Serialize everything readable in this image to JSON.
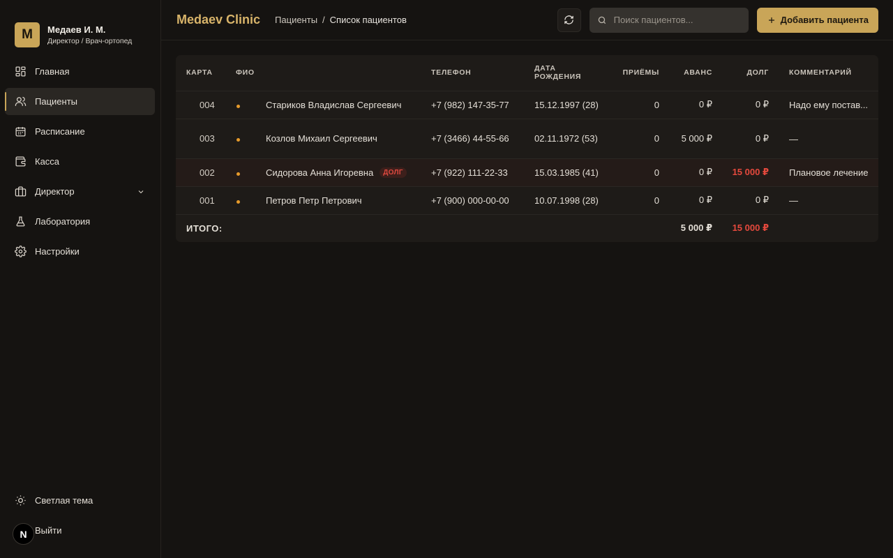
{
  "profile": {
    "avatar_letter": "M",
    "name": "Медаев И. М.",
    "role": "Директор / Врач-ортопед"
  },
  "nav": {
    "items": [
      {
        "label": "Главная",
        "icon": "grid-icon"
      },
      {
        "label": "Пациенты",
        "icon": "users-icon",
        "active": true
      },
      {
        "label": "Расписание",
        "icon": "calendar-icon"
      },
      {
        "label": "Касса",
        "icon": "wallet-icon"
      },
      {
        "label": "Директор",
        "icon": "briefcase-icon",
        "expandable": true
      },
      {
        "label": "Лаборатория",
        "icon": "flask-icon"
      },
      {
        "label": "Настройки",
        "icon": "gear-icon"
      }
    ],
    "bottom": [
      {
        "label": "Светлая тема",
        "icon": "sun-icon"
      },
      {
        "label": "Выйти",
        "icon": "logout-icon"
      }
    ],
    "badge_letter": "N"
  },
  "header": {
    "brand": "Medaev Clinic",
    "breadcrumb": [
      "Пациенты",
      "/",
      "Список пациентов"
    ],
    "search_placeholder": "Поиск пациентов...",
    "add_label": "Добавить пациента"
  },
  "table": {
    "columns": {
      "card": "КАРТА",
      "name": "ФИО",
      "phone": "ТЕЛЕФОН",
      "dob_line1": "ДАТА",
      "dob_line2": "РОЖДЕНИЯ",
      "visits": "ПРИЁМЫ",
      "advance": "АВАНС",
      "debt": "ДОЛГ",
      "comment": "КОММЕНТАРИЙ"
    },
    "rows": [
      {
        "card": "004",
        "name": "Стариков Владислав Сергеевич",
        "phone": "+7 (982) 147-35-77",
        "dob": "15.12.1997 (28)",
        "visits": "0",
        "advance": "0 ₽",
        "debt": "0 ₽",
        "comment": "Надо ему постав..."
      },
      {
        "card": "003",
        "name": "Козлов Михаил Сергеевич",
        "phone": "+7 (3466) 44-55-66",
        "dob": "02.11.1972 (53)",
        "visits": "0",
        "advance": "5 000 ₽",
        "debt": "0 ₽",
        "comment": "—"
      },
      {
        "card": "002",
        "name": "Сидорова Анна Игоревна",
        "badge": "ДОЛГ",
        "phone": "+7 (922) 111-22-33",
        "dob": "15.03.1985 (41)",
        "visits": "0",
        "advance": "0 ₽",
        "debt": "15 000 ₽",
        "comment": "Плановое лечение"
      },
      {
        "card": "001",
        "name": "Петров Петр Петрович",
        "phone": "+7 (900) 000-00-00",
        "dob": "10.07.1998 (28)",
        "visits": "0",
        "advance": "0 ₽",
        "debt": "0 ₽",
        "comment": "—"
      }
    ],
    "total": {
      "label": "ИТОГО:",
      "advance": "5 000 ₽",
      "debt": "15 000 ₽"
    }
  },
  "colors": {
    "accent": "#c9a558",
    "debt": "#e5493d",
    "dot": "#e79b2b"
  }
}
